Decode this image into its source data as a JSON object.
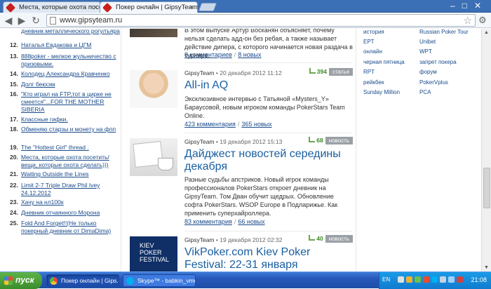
{
  "browser": {
    "tabs": [
      {
        "title": "Места, которые охота посе",
        "close": "×"
      },
      {
        "title": "Покер онлайн | GipsyTeam",
        "close": "×"
      }
    ],
    "url": "www.gipsyteam.ru"
  },
  "left_list": [
    {
      "num": "",
      "text": "дневник металлического рогулъяра"
    },
    {
      "num": "12.",
      "text": "Наталья Евдакова и ЦГМ"
    },
    {
      "num": "13.",
      "text": "888poker - мелкое жульничество с призовыми."
    },
    {
      "num": "14.",
      "text": "Колодец Александра Кравченко"
    },
    {
      "num": "15.",
      "text": "Долг бекхэм"
    },
    {
      "num": "16.",
      "text": "\"Кто играл на FTP,тот в цирке не смеется\"...FOR THE MOTHER SIBERIA"
    },
    {
      "num": "17.",
      "text": "Классные гифки."
    },
    {
      "num": "18.",
      "text": "Обменяю старзы и монету на фпп"
    },
    {
      "num": "19.",
      "text": "The \"Hottest Girl\" thread ."
    },
    {
      "num": "20.",
      "text": "Места, которые охота посетить/ вещи, которые охота сделать)))"
    },
    {
      "num": "21.",
      "text": "Waiting Outside the Lines"
    },
    {
      "num": "22.",
      "text": "Limit 2-7 Triple Draw Phil Ivey 24.12.2012"
    },
    {
      "num": "23.",
      "text": "Хачу на нл100к"
    },
    {
      "num": "24.",
      "text": "Дневник отчаянного Морона"
    },
    {
      "num": "25.",
      "text": "Fold And Forget!!(Не только покерный дневник от DimaDima)"
    }
  ],
  "posts": [
    {
      "desc": "В этом выпуске Артур Восканян объясняет, почему нельзя сделать адд-он без ребая, а также называет действие дипера, с которого начинается новая раздача в турнире.",
      "comments": "8 комментариев",
      "news": "8 новых"
    },
    {
      "author": "GipsyTeam",
      "date": "• 20 декабря 2012 11:12",
      "likes": "394",
      "badge": "статья",
      "title": "All-in AQ",
      "desc": "Эксклюзивное интервью с Татьяной «Mysters_Y» Барауcовой, новым игроком команды PokerStars Team Online.",
      "comments": "423 комментария",
      "news": "365 новых"
    },
    {
      "author": "GipsyTeam",
      "date": "• 19 декабря 2012 15:13",
      "likes": "68",
      "badge": "новость",
      "title": "Дайджест новостей середины декабря",
      "desc": "Разные судьбы апстриков. Новый игрок команды профессионалов PokerStars откроет дневник на GipsyTeam. Том Дван обучит щедрых. Обновление софта PokerStars. WSOP Europe в Подларижье. Как применить суперхайроллера.",
      "comments": "83 комментария",
      "news": "66 новых"
    },
    {
      "author": "GipsyTeam",
      "date": "• 19 декабря 2012 02:32",
      "likes": "40",
      "badge": "новость",
      "title": "VikPoker.com Kiev Poker Festival: 22-31 января",
      "thumb_lines": [
        "KIEV",
        "POKER",
        "FESTIVAL"
      ]
    }
  ],
  "tags_left": [
    "история",
    "EPT",
    "онлайн",
    "черная пятница",
    "RPT",
    "рейкбек",
    "Sunday Million"
  ],
  "tags_right": [
    "Russian Poker Tour",
    "Unibet",
    "WPT",
    "запрет покера",
    "форум",
    "PokerVplus",
    "PCA"
  ],
  "taskbar": {
    "start": "пуск",
    "tasks": [
      {
        "label": "Покер онлайн | Gips..."
      },
      {
        "label": "Skype™ - babkin_vmuk"
      }
    ],
    "lang": "EN",
    "clock": "21:08"
  },
  "colors": {
    "link": "#1a4b8c",
    "title": "#1a5fa0",
    "likes": "#3a8a22",
    "taskbar": "#2656b9"
  }
}
